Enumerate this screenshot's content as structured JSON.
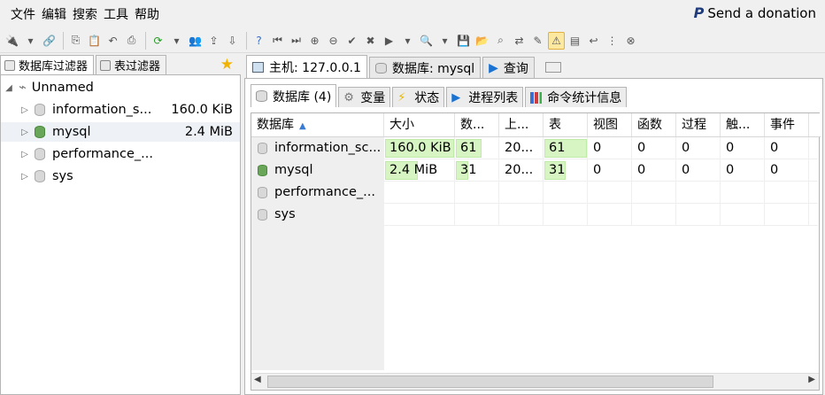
{
  "menu": [
    "文件",
    "编辑",
    "搜索",
    "工具",
    "帮助"
  ],
  "donation": {
    "icon": "paypal-icon",
    "label": "Send a donation"
  },
  "left_tabs": [
    {
      "label": "数据库过滤器"
    },
    {
      "label": "表过滤器"
    }
  ],
  "tree": {
    "root": "Unnamed",
    "items": [
      {
        "name": "information_s...",
        "size": "160.0 KiB"
      },
      {
        "name": "mysql",
        "size": "2.4 MiB"
      },
      {
        "name": "performance_...",
        "size": ""
      },
      {
        "name": "sys",
        "size": ""
      }
    ]
  },
  "main_tabs": [
    {
      "label": "主机: 127.0.0.1"
    },
    {
      "label": "数据库: mysql"
    },
    {
      "label": "查询"
    }
  ],
  "sub_tabs": [
    {
      "label": "数据库 (4)"
    },
    {
      "label": "变量"
    },
    {
      "label": "状态"
    },
    {
      "label": "进程列表"
    },
    {
      "label": "命令统计信息"
    }
  ],
  "grid": {
    "columns": [
      "数据库",
      "大小",
      "数...",
      "上...",
      "表",
      "视图",
      "函数",
      "过程",
      "触...",
      "事件"
    ],
    "rows": [
      [
        "information_sc...",
        "160.0 KiB",
        "61",
        "20...",
        "61",
        "0",
        "0",
        "0",
        "0",
        "0"
      ],
      [
        "mysql",
        "2.4 MiB",
        "31",
        "20...",
        "31",
        "0",
        "0",
        "0",
        "0",
        "0"
      ],
      [
        "performance_...",
        "",
        "",
        "",
        "",
        "",
        "",
        "",
        "",
        ""
      ],
      [
        "sys",
        "",
        "",
        "",
        "",
        "",
        "",
        "",
        "",
        ""
      ]
    ],
    "bars": [
      [
        1.0,
        0.6,
        1.0
      ],
      [
        0.48,
        0.3,
        0.51
      ]
    ]
  }
}
